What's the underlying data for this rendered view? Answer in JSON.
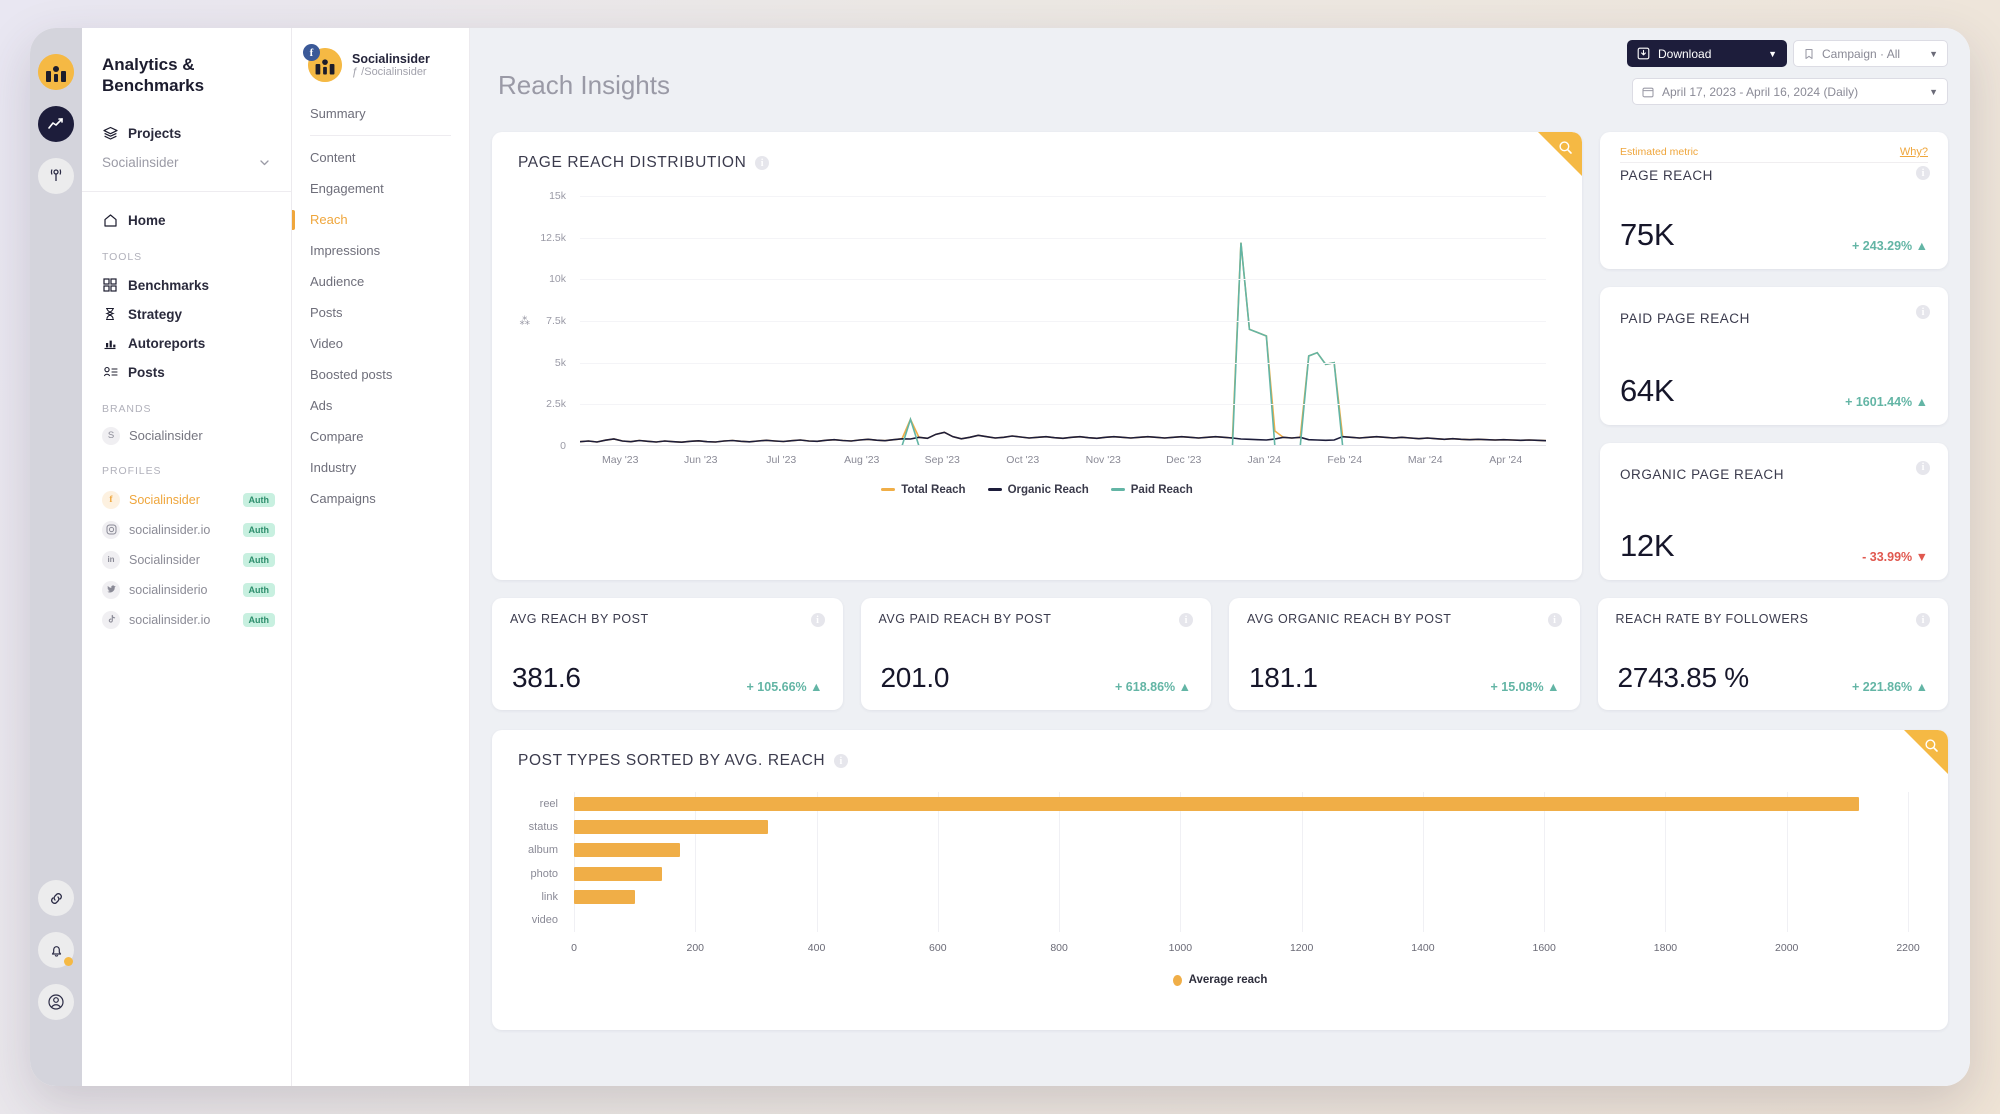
{
  "rail": {
    "icons": [
      {
        "name": "user-avatar-icon",
        "glyph": ""
      },
      {
        "name": "analytics-icon",
        "glyph": "↗"
      },
      {
        "name": "broadcast-icon",
        "glyph": "((¦))"
      }
    ],
    "bottom_icons": [
      {
        "name": "link-icon",
        "glyph": "⎇"
      },
      {
        "name": "bell-icon",
        "glyph": "ὑ4"
      },
      {
        "name": "account-icon",
        "glyph": "◎"
      }
    ]
  },
  "sidebar": {
    "title": "Analytics & Benchmarks",
    "projects_label": "Projects",
    "project_selected": "Socialinsider",
    "home_label": "Home",
    "tools_label": "TOOLS",
    "tools": [
      {
        "label": "Benchmarks",
        "icon": "grid-icon"
      },
      {
        "label": "Strategy",
        "icon": "hourglass-icon"
      },
      {
        "label": "Autoreports",
        "icon": "bar-chart-icon"
      },
      {
        "label": "Posts",
        "icon": "posts-icon"
      }
    ],
    "brands_label": "BRANDS",
    "brands": [
      {
        "label": "Socialinsider",
        "initial": "S"
      }
    ],
    "profiles_label": "PROFILES",
    "profiles": [
      {
        "label": "Socialinsider",
        "network": "f",
        "badge": "Auth",
        "active": true
      },
      {
        "label": "socialinsider.io",
        "network": "◎",
        "badge": "Auth",
        "active": false
      },
      {
        "label": "Socialinsider",
        "network": "in",
        "badge": "Auth",
        "active": false
      },
      {
        "label": "socialinsiderio",
        "network": "✉",
        "badge": "Auth",
        "active": false
      },
      {
        "label": "socialinsider.io",
        "network": "♪",
        "badge": "Auth",
        "active": false
      }
    ]
  },
  "subnav": {
    "account_name": "Socialinsider",
    "account_handle": "ƒ /Socialinsider",
    "items": [
      {
        "label": "Summary",
        "active": false,
        "separator_after": true
      },
      {
        "label": "Content",
        "active": false
      },
      {
        "label": "Engagement",
        "active": false
      },
      {
        "label": "Reach",
        "active": true
      },
      {
        "label": "Impressions",
        "active": false
      },
      {
        "label": "Audience",
        "active": false
      },
      {
        "label": "Posts",
        "active": false
      },
      {
        "label": "Video",
        "active": false
      },
      {
        "label": "Boosted posts",
        "active": false
      },
      {
        "label": "Ads",
        "active": false
      },
      {
        "label": "Compare",
        "active": false
      },
      {
        "label": "Industry",
        "active": false
      },
      {
        "label": "Campaigns",
        "active": false
      }
    ]
  },
  "header": {
    "title": "Reach Insights",
    "download_label": "Download",
    "campaign_label": "Campaign · All",
    "date_range": "April 17, 2023 - April 16, 2024 (Daily)"
  },
  "main_chart": {
    "title": "PAGE REACH DISTRIBUTION"
  },
  "bar_chart_card": {
    "title": "POST TYPES SORTED BY AVG. REACH"
  },
  "kpis_right": [
    {
      "estimated_label": "Estimated metric",
      "why_label": "Why?",
      "label": "PAGE REACH",
      "value": "75K",
      "delta": "+ 243.29%",
      "direction": "up"
    },
    {
      "label": "PAID PAGE REACH",
      "value": "64K",
      "delta": "+ 1601.44%",
      "direction": "up"
    },
    {
      "label": "ORGANIC PAGE REACH",
      "value": "12K",
      "delta": "- 33.99%",
      "direction": "down"
    }
  ],
  "kpis_row": [
    {
      "label": "AVG REACH BY POST",
      "value": "381.6",
      "delta": "+ 105.66%",
      "direction": "up"
    },
    {
      "label": "AVG PAID REACH BY POST",
      "value": "201.0",
      "delta": "+ 618.86%",
      "direction": "up"
    },
    {
      "label": "AVG ORGANIC REACH BY POST",
      "value": "181.1",
      "delta": "+ 15.08%",
      "direction": "up"
    },
    {
      "label": "REACH RATE BY FOLLOWERS",
      "value": "2743.85 %",
      "delta": "+ 221.86%",
      "direction": "up"
    }
  ],
  "colors": {
    "accent": "#efa63c",
    "total_reach": "#f0ae47",
    "organic_reach": "#1d1d3b",
    "paid_reach": "#63b5a5",
    "up": "#63b5a5",
    "down": "#e0584f",
    "dark": "#1d1d3b"
  },
  "chart_data": [
    {
      "type": "line",
      "title": "PAGE REACH DISTRIBUTION",
      "xlabel": "",
      "ylabel": "",
      "ylim": [
        0,
        15000
      ],
      "yticks": [
        0,
        2500,
        5000,
        7500,
        10000,
        12500,
        15000
      ],
      "ytick_labels": [
        "0",
        "2.5k",
        "5k",
        "7.5k",
        "10k",
        "12.5k",
        "15k"
      ],
      "x_tick_labels": [
        "May '23",
        "Jun '23",
        "Jul '23",
        "Aug '23",
        "Sep '23",
        "Oct '23",
        "Nov '23",
        "Dec '23",
        "Jan '24",
        "Feb '24",
        "Mar '24",
        "Apr '24"
      ],
      "grid": true,
      "legend": [
        "Total Reach",
        "Organic Reach",
        "Paid Reach"
      ],
      "legend_position": "bottom",
      "series": [
        {
          "name": "Total Reach",
          "color": "#f0ae47",
          "values": [
            260,
            300,
            240,
            350,
            420,
            300,
            260,
            330,
            280,
            240,
            300,
            260,
            230,
            280,
            310,
            260,
            240,
            300,
            330,
            280,
            250,
            300,
            340,
            300,
            270,
            320,
            360,
            300,
            280,
            340,
            380,
            330,
            300,
            360,
            400,
            350,
            320,
            380,
            430,
            1600,
            520,
            460,
            700,
            820,
            560,
            430,
            520,
            640,
            560,
            480,
            520,
            600,
            540,
            480,
            520,
            560,
            500,
            460,
            520,
            560,
            500,
            460,
            520,
            560,
            520,
            480,
            520,
            560,
            520,
            480,
            520,
            560,
            520,
            480,
            520,
            560,
            520,
            480,
            12200,
            7000,
            6800,
            6600,
            900,
            520,
            480,
            520,
            5400,
            5600,
            4900,
            5000,
            560,
            520,
            480,
            520,
            560,
            520,
            480,
            520,
            480,
            440,
            480,
            440,
            400,
            440,
            400,
            380,
            400,
            380,
            360,
            380,
            360,
            340,
            360,
            340,
            320
          ]
        },
        {
          "name": "Organic Reach",
          "color": "#1d1d3b",
          "values": [
            260,
            300,
            240,
            350,
            420,
            300,
            260,
            330,
            280,
            240,
            300,
            260,
            230,
            280,
            310,
            260,
            240,
            300,
            330,
            280,
            250,
            300,
            340,
            300,
            270,
            320,
            360,
            300,
            280,
            340,
            380,
            330,
            300,
            360,
            400,
            350,
            320,
            380,
            430,
            420,
            520,
            460,
            700,
            820,
            560,
            430,
            520,
            640,
            560,
            480,
            520,
            600,
            540,
            480,
            520,
            560,
            500,
            460,
            520,
            560,
            500,
            460,
            520,
            560,
            520,
            480,
            520,
            560,
            520,
            480,
            520,
            560,
            520,
            480,
            520,
            560,
            520,
            480,
            420,
            400,
            380,
            360,
            420,
            520,
            480,
            520,
            380,
            360,
            340,
            360,
            560,
            520,
            480,
            520,
            560,
            520,
            480,
            520,
            480,
            440,
            480,
            440,
            400,
            440,
            400,
            380,
            400,
            380,
            360,
            380,
            360,
            340,
            360,
            340,
            320
          ]
        },
        {
          "name": "Paid Reach",
          "color": "#63b5a5",
          "values": [
            0,
            0,
            0,
            0,
            0,
            0,
            0,
            0,
            0,
            0,
            0,
            0,
            0,
            0,
            0,
            0,
            0,
            0,
            0,
            0,
            0,
            0,
            0,
            0,
            0,
            0,
            0,
            0,
            0,
            0,
            0,
            0,
            0,
            0,
            0,
            0,
            0,
            0,
            0,
            1600,
            0,
            0,
            0,
            0,
            0,
            0,
            0,
            0,
            0,
            0,
            0,
            0,
            0,
            0,
            0,
            0,
            0,
            0,
            0,
            0,
            0,
            0,
            0,
            0,
            0,
            0,
            0,
            0,
            0,
            0,
            0,
            0,
            0,
            0,
            0,
            0,
            0,
            0,
            12200,
            7000,
            6800,
            6600,
            0,
            0,
            0,
            0,
            5400,
            5600,
            4900,
            5000,
            0,
            0,
            0,
            0,
            0,
            0,
            0,
            0,
            0,
            0,
            0,
            0,
            0,
            0,
            0,
            0,
            0,
            0,
            0,
            0,
            0,
            0,
            0,
            0
          ]
        }
      ]
    },
    {
      "type": "bar",
      "orientation": "horizontal",
      "title": "POST TYPES SORTED BY AVG. REACH",
      "categories": [
        "reel",
        "status",
        "album",
        "photo",
        "link",
        "video"
      ],
      "values": [
        2120,
        320,
        175,
        145,
        100,
        0
      ],
      "xlabel": "",
      "ylabel": "",
      "xlim": [
        0,
        2200
      ],
      "xticks": [
        0,
        200,
        400,
        600,
        800,
        1000,
        1200,
        1400,
        1600,
        1800,
        2000,
        2200
      ],
      "legend": [
        "Average reach"
      ],
      "legend_position": "bottom",
      "color": "#f0ae47",
      "grid": true
    }
  ]
}
